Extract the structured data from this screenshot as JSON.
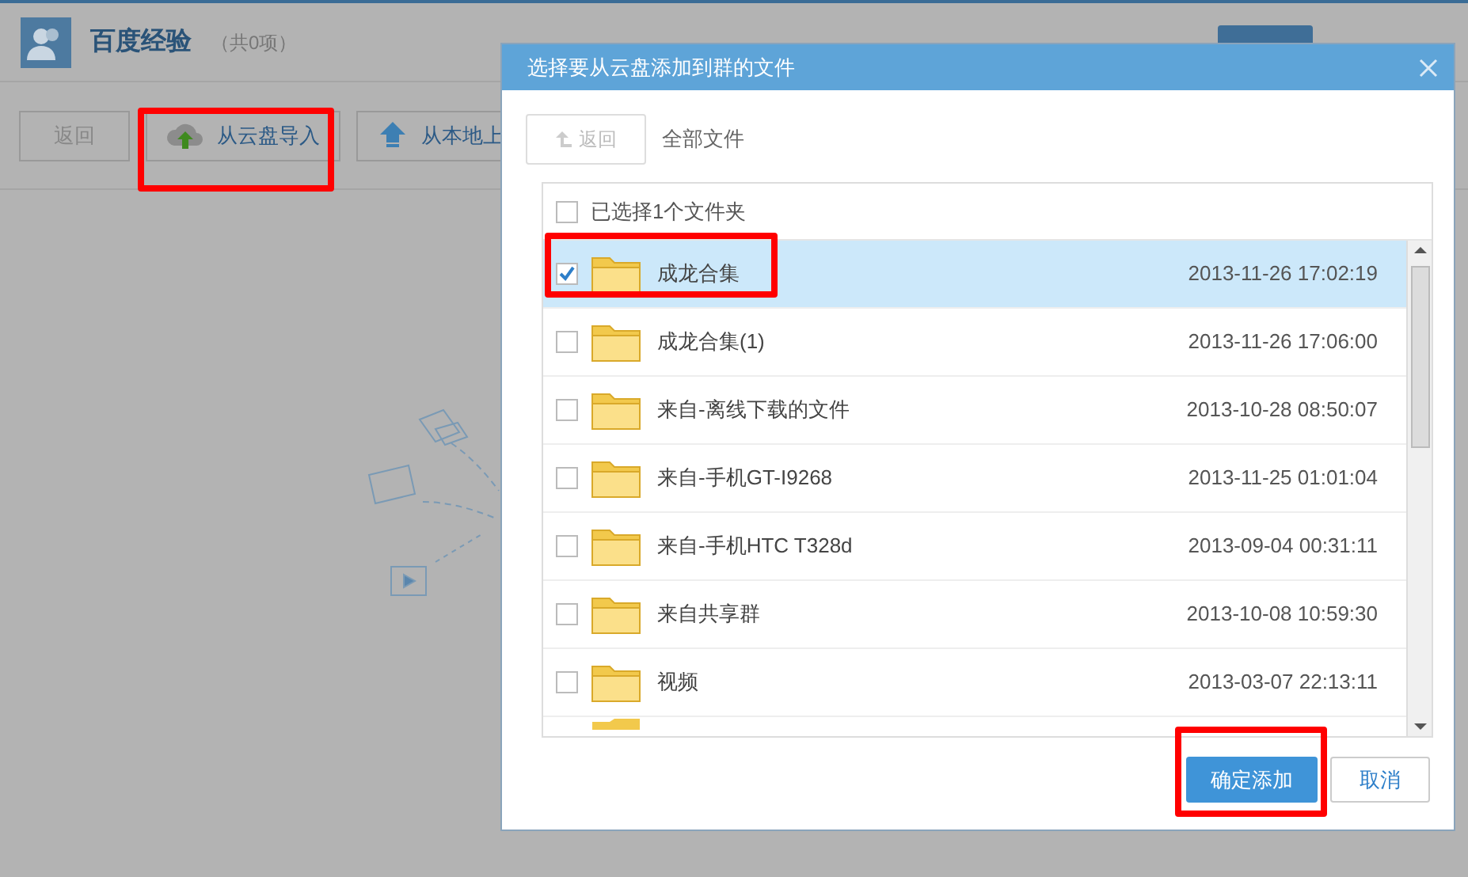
{
  "page": {
    "title": "百度经验",
    "count": "（共0项）",
    "toolbar": [
      {
        "kind": "back",
        "label": "返回"
      },
      {
        "kind": "cloud",
        "label": "从云盘导入"
      },
      {
        "kind": "upload",
        "label": "从本地上"
      }
    ]
  },
  "dialog": {
    "title": "选择要从云盘添加到群的文件",
    "back": "返回",
    "path": "全部文件",
    "header": {
      "label": "已选择1个文件夹",
      "checked": false
    },
    "files": [
      {
        "name": "成龙合集",
        "date": "2013-11-26 17:02:19",
        "selected": true
      },
      {
        "name": "成龙合集(1)",
        "date": "2013-11-26 17:06:00",
        "selected": false
      },
      {
        "name": "来自-离线下载的文件",
        "date": "2013-10-28 08:50:07",
        "selected": false
      },
      {
        "name": "来自-手机GT-I9268",
        "date": "2013-11-25 01:01:04",
        "selected": false
      },
      {
        "name": "来自-手机HTC T328d",
        "date": "2013-09-04 00:31:11",
        "selected": false
      },
      {
        "name": "来自共享群",
        "date": "2013-10-08 10:59:30",
        "selected": false
      },
      {
        "name": "视频",
        "date": "2013-03-07 22:13:11",
        "selected": false
      }
    ],
    "confirm": "确定添加",
    "cancel": "取消"
  }
}
